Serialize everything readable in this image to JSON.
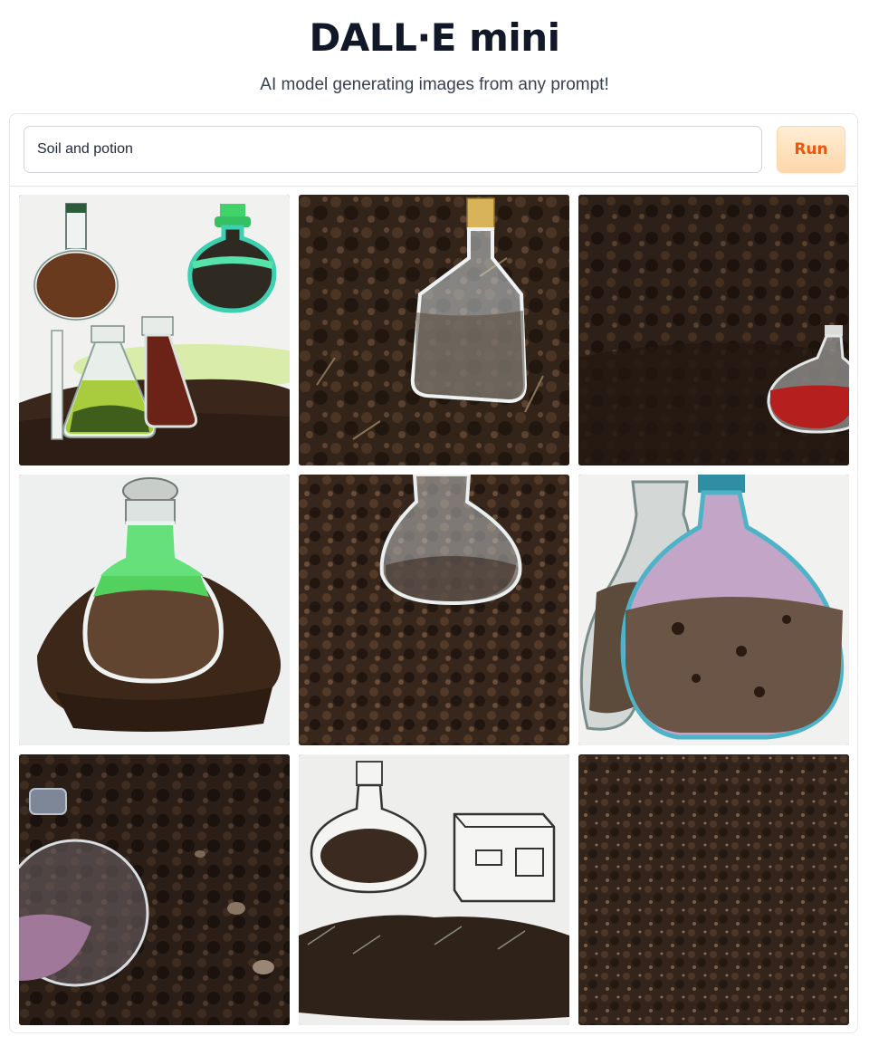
{
  "header": {
    "title": "DALL·E mini",
    "subtitle": "AI model generating images from any prompt!"
  },
  "prompt": {
    "value": "Soil and potion",
    "run_label": "Run"
  },
  "colors": {
    "accent": "#ea580c",
    "button_bg": "#fed7aa",
    "soil": "#3a2a1f"
  },
  "gallery": {
    "images": [
      {
        "icon": "flasks-on-soil-image"
      },
      {
        "icon": "bottle-on-soil-image"
      },
      {
        "icon": "red-potion-on-soil-image"
      },
      {
        "icon": "green-flask-soil-pile-image"
      },
      {
        "icon": "glass-flask-in-soil-image"
      },
      {
        "icon": "soil-filled-bottles-image"
      },
      {
        "icon": "glass-orb-on-soil-image"
      },
      {
        "icon": "sketch-flask-and-box-image"
      },
      {
        "icon": "soil-texture-image"
      }
    ]
  }
}
